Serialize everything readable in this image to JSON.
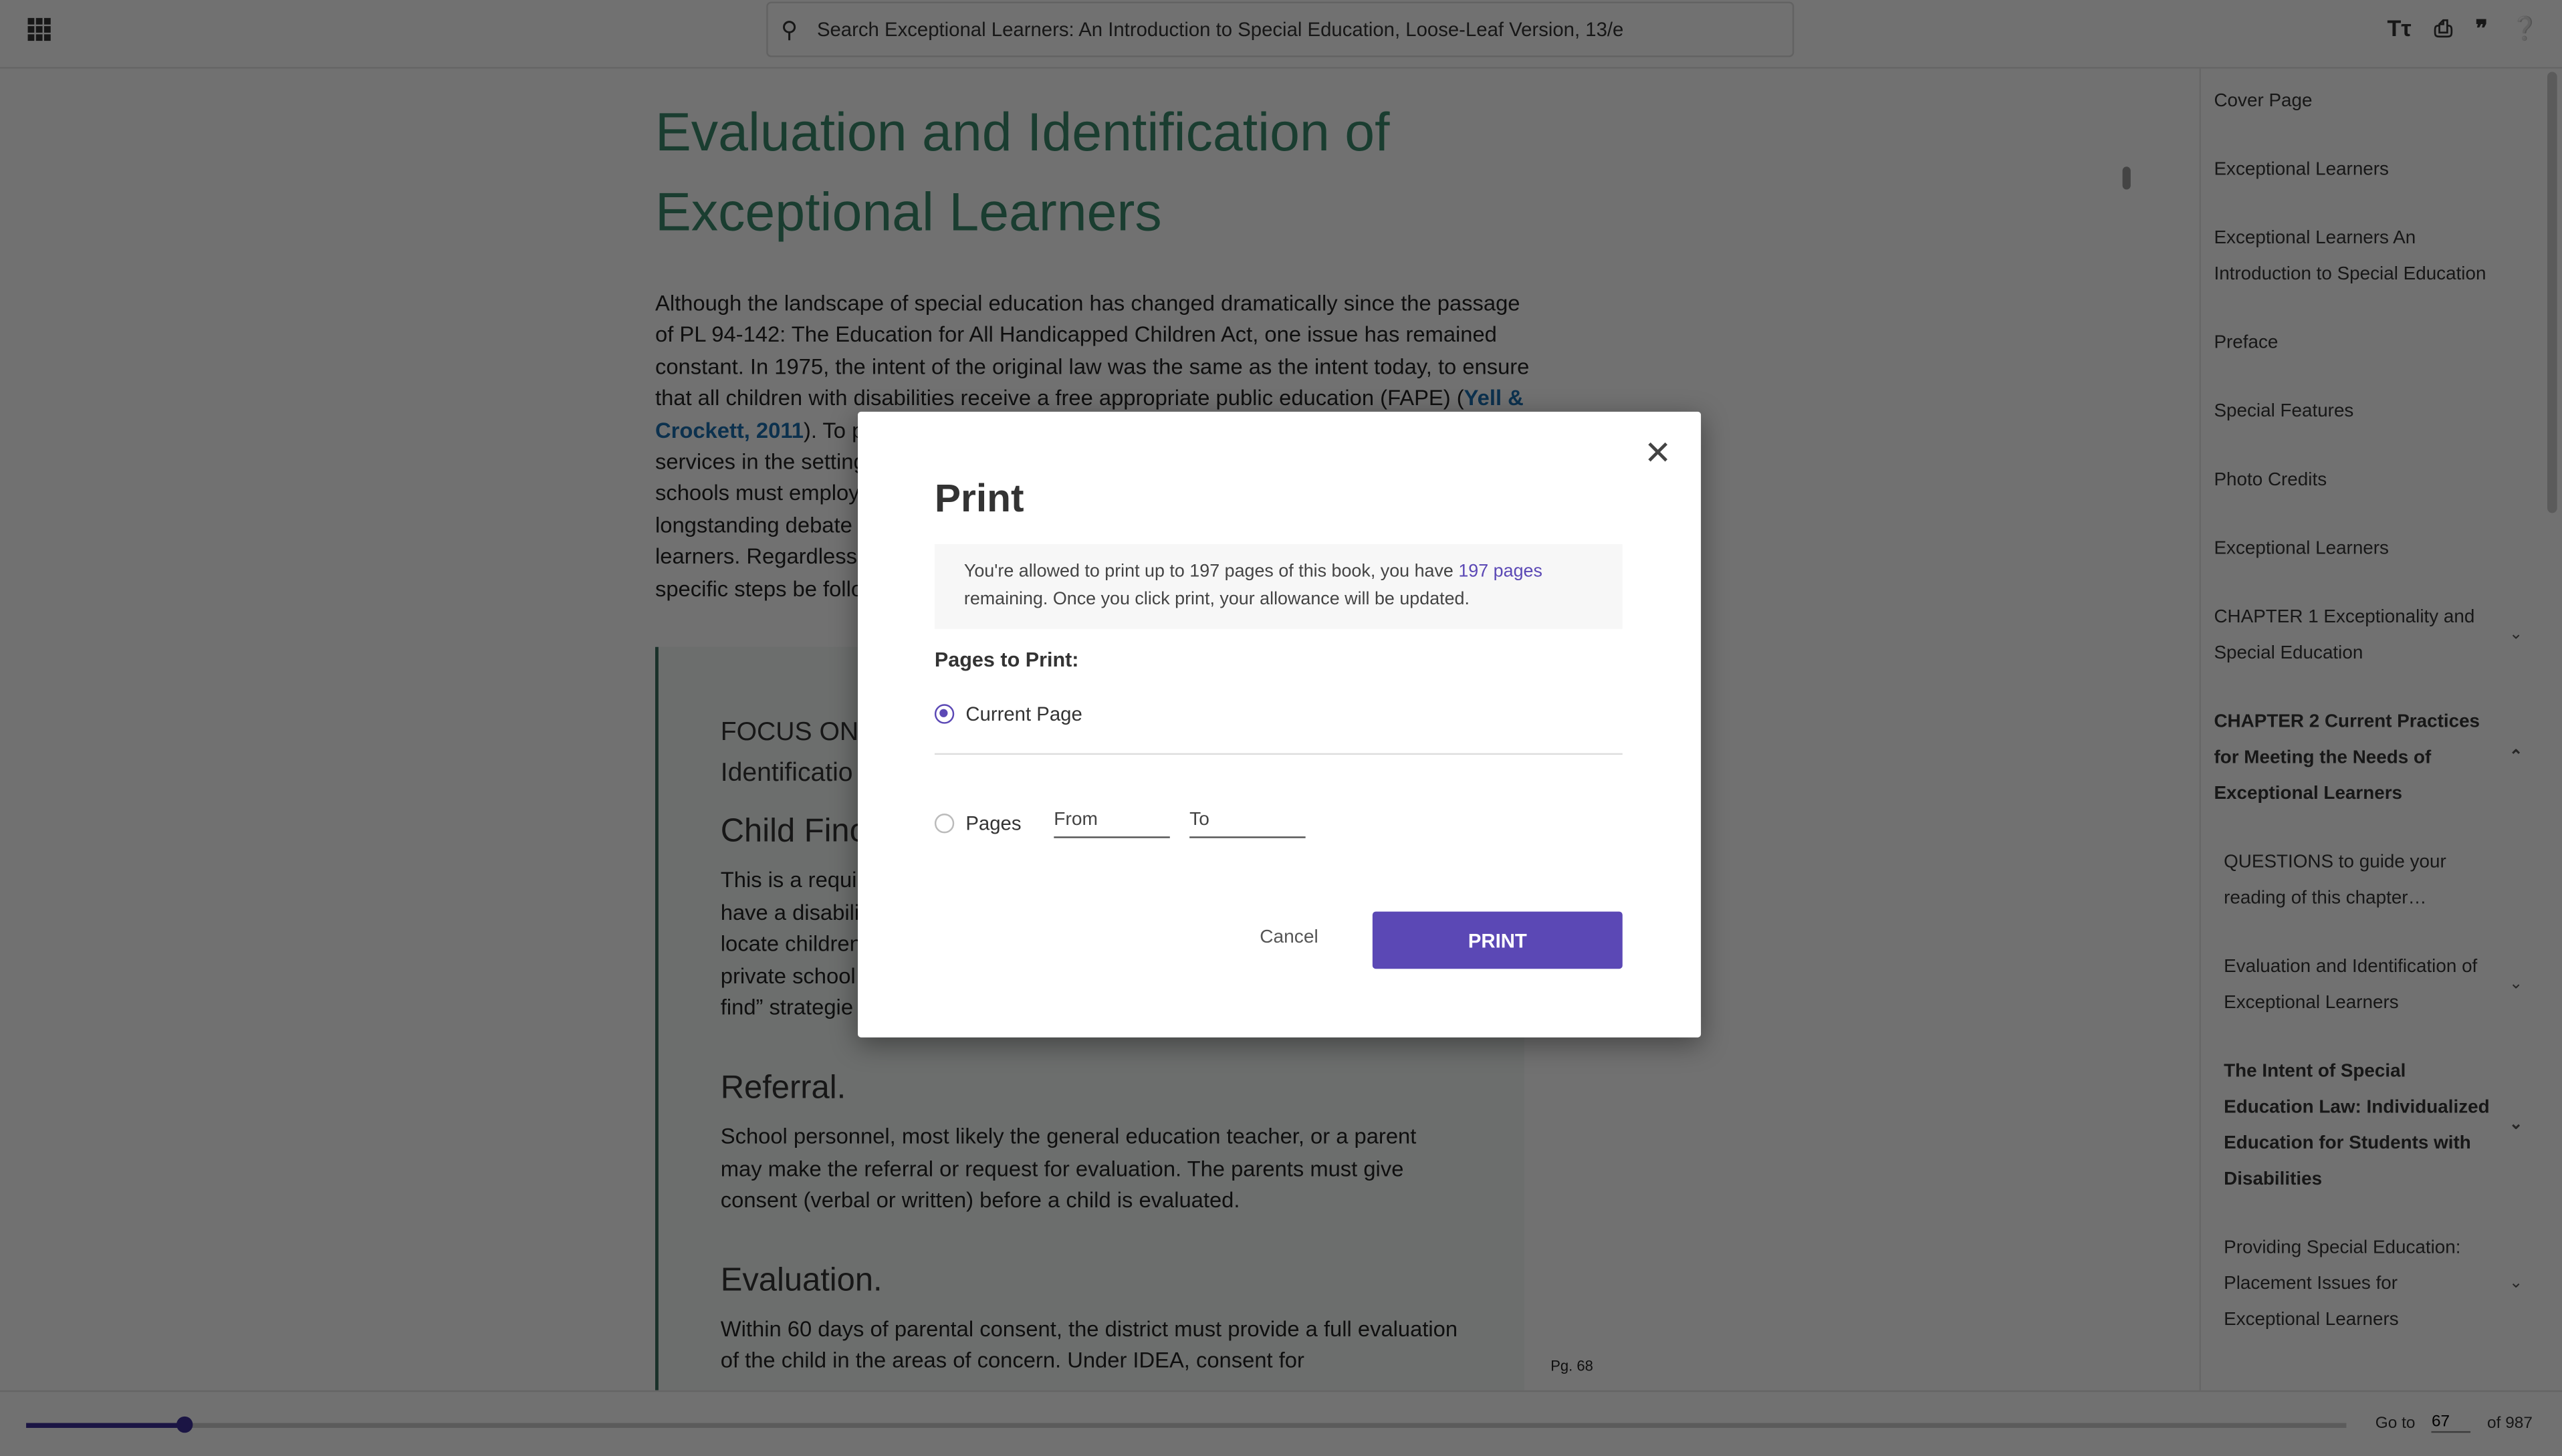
{
  "header": {
    "search_placeholder": "Search Exceptional Learners: An Introduction to Special Education, Loose-Leaf Version, 13/e",
    "icons": [
      "apps-grid-icon",
      "search-icon",
      "text-size-icon",
      "print-icon",
      "quote-icon",
      "help-icon"
    ]
  },
  "content": {
    "title": "Evaluation and Identification of Exceptional Learners",
    "para_a": "Although the landscape of special education has changed dramatically since the passage of PL 94-142: The Education for All Handicapped Children Act, one issue has remained constant. In 1975, the intent of the original law was the same as the intent today, to ensure that all children with disabilities receive a free appropriate public education (FAPE) (",
    "citation": "Yell & Crockett, 2011",
    "para_b": "). To p",
    "para_lines": [
      "services in the setting",
      "schools must employ",
      "longstanding debate",
      "learners. Regardless",
      "specific steps be follo"
    ],
    "focus": "FOCUS ON",
    "focus2": "Identificatio",
    "child_find": "Child Finc",
    "child_lines": [
      "This is a requir",
      "have a disabili",
      "locate children",
      "private school",
      "find” strategie"
    ],
    "referral_title": "Referral.",
    "referral_text": "School personnel, most likely the general education teacher, or a parent may make the referral or request for evaluation. The parents must give consent (verbal or written) before a child is evaluated.",
    "evaluation_title": "Evaluation.",
    "evaluation_text": "Within 60 days of parental consent, the district must provide a full evaluation of the child in the areas of concern. Under IDEA, consent for",
    "page_label": "Pg. 68"
  },
  "toc": [
    {
      "label": "Cover Page"
    },
    {
      "label": "Exceptional Learners"
    },
    {
      "label": "Exceptional Learners An Introduction to Special Education"
    },
    {
      "label": "Preface"
    },
    {
      "label": "Special Features"
    },
    {
      "label": "Photo Credits"
    },
    {
      "label": "Exceptional Learners"
    },
    {
      "label": "CHAPTER 1 Exceptionality and Special Education",
      "chevron": "⌄"
    },
    {
      "label": "CHAPTER 2 Current Practices for Meeting the Needs of Exceptional Learners",
      "chevron": "⌃"
    },
    {
      "label": "QUESTIONS to guide your reading of this chapter…"
    },
    {
      "label": "Evaluation and Identification of Exceptional Learners",
      "chevron": "⌄"
    },
    {
      "label": "The Intent of Special Education Law: Individualized Education for Students with Disabilities",
      "chevron": "⌄"
    },
    {
      "label": "Providing Special Education: Placement Issues for Exceptional Learners",
      "chevron": "⌄"
    }
  ],
  "footer": {
    "goto_label": "Go to",
    "page_value": "67",
    "of_label": "of 987",
    "progress_percent": 6.8
  },
  "dialog": {
    "title": "Print",
    "info_a": "You're allowed to print up to 197 pages of this book, you have ",
    "info_link": "197 pages",
    "info_b": " remaining. Once you click print, your allowance will be updated.",
    "pages_to_print": "Pages to Print:",
    "option_current": "Current Page",
    "option_pages": "Pages",
    "from_placeholder": "From",
    "to_placeholder": "To",
    "cancel": "Cancel",
    "print": "PRINT",
    "accent_color": "#5b48b5"
  }
}
